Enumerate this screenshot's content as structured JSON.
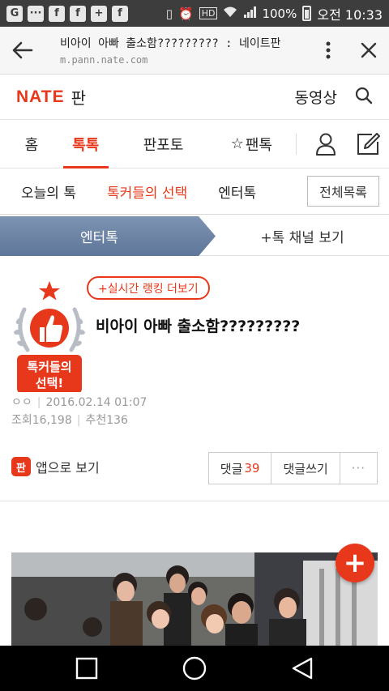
{
  "status_bar": {
    "left_icons": [
      "g-icon",
      "chat-icon",
      "facebook-icon",
      "facebook-icon",
      "add-person-icon",
      "facebook-icon"
    ],
    "battery_percent": "100%",
    "time": "오전 10:33",
    "hd_label": "HD"
  },
  "url_bar": {
    "page_title": "비아이 아빠 출소함????????? : 네이트판",
    "host": "m.pann.nate.com"
  },
  "header": {
    "logo_text": "NATE",
    "logo_suffix": "판",
    "video_link": "동영상"
  },
  "main_tabs": [
    {
      "label": "홈",
      "active": false
    },
    {
      "label": "톡톡",
      "active": true
    },
    {
      "label": "판포토",
      "active": false
    },
    {
      "label": "팬톡",
      "active": false
    }
  ],
  "sub_tabs": [
    {
      "label": "오늘의 톡",
      "active": false
    },
    {
      "label": "톡커들의 선택",
      "active": true
    },
    {
      "label": "엔터톡",
      "active": false
    }
  ],
  "all_list_button": "전체목록",
  "channel": {
    "current": "엔터톡",
    "more": "+톡 채널 보기"
  },
  "article": {
    "ranking_button": "+실시간 랭킹 더보기",
    "badge_text_line1": "톡커들의",
    "badge_text_line2": "선택!",
    "title": "비아이 아빠 출소함?????????",
    "author": "ㅇㅇ",
    "date": "2016.02.14 01:07",
    "views_label": "조회16,198",
    "recommend_label": "추천136",
    "app_view_label": "앱으로 보기",
    "app_logo": "판",
    "comments_label": "댓글",
    "comments_count": "39",
    "write_comment_label": "댓글쓰기",
    "more_label": "···"
  },
  "colors": {
    "accent": "#e8381b",
    "channel_bg": "#6b82a4",
    "status_bar": "#3d3d3d"
  }
}
